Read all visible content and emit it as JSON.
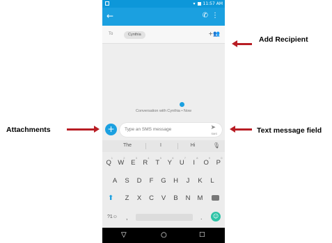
{
  "status_bar": {
    "time": "11:57 AM"
  },
  "app_bar": {
    "back_icon": "arrow-left-icon",
    "call_icon": "phone-icon",
    "more_icon": "more-vert-icon"
  },
  "recipients": {
    "to_label": "To",
    "chip": "Cynthia",
    "add_icon": "add-person-icon"
  },
  "conversation": {
    "notice": "Conversation with Cynthia • Now"
  },
  "composer": {
    "attach_glyph": "+",
    "placeholder": "Type an SMS message",
    "send_sub": "SMS"
  },
  "keyboard": {
    "suggestions": [
      "The",
      "I",
      "Hi"
    ],
    "row1": [
      "Q",
      "W",
      "E",
      "R",
      "T",
      "Y",
      "U",
      "I",
      "O",
      "P"
    ],
    "row1_numbers": [
      "1",
      "2",
      "3",
      "4",
      "5",
      "6",
      "7",
      "8",
      "9",
      "0"
    ],
    "row2": [
      "A",
      "S",
      "D",
      "F",
      "G",
      "H",
      "J",
      "K",
      "L"
    ],
    "row3": [
      "Z",
      "X",
      "C",
      "V",
      "B",
      "N",
      "M"
    ],
    "symbols": "?1☺",
    "comma": ",",
    "period": "."
  },
  "annotations": {
    "add_recipient": "Add Recipient",
    "attachments": "Attachments",
    "text_field": "Text message field"
  },
  "colors": {
    "accent": "#1ba0e0",
    "arrow": "#b81d24",
    "emoji": "#2dc3a6"
  }
}
